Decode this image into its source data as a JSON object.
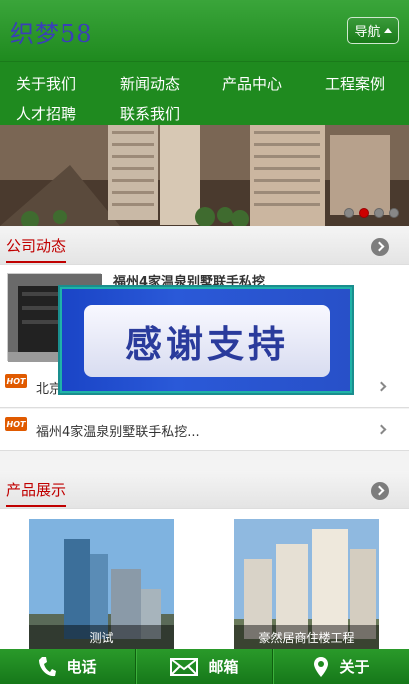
{
  "header": {
    "logo": "织梦58",
    "nav_label": "导航"
  },
  "menu": [
    "关于我们",
    "新闻动态",
    "产品中心",
    "工程案例",
    "人才招聘",
    "联系我们"
  ],
  "banner": {
    "slide_count": 4,
    "active_slide": 2
  },
  "news_section": {
    "title": "公司动态",
    "feature_title": "福州4家温泉别墅联手私挖",
    "items": [
      "北京",
      "福州4家温泉别墅联手私挖..."
    ],
    "hot_label": "HOT"
  },
  "popup": {
    "text": "感谢支持"
  },
  "products_section": {
    "title": "产品展示",
    "items": [
      "测试",
      "豪然居商住楼工程"
    ]
  },
  "bottom_bar": {
    "phone": "电话",
    "mail": "邮箱",
    "about": "关于"
  }
}
